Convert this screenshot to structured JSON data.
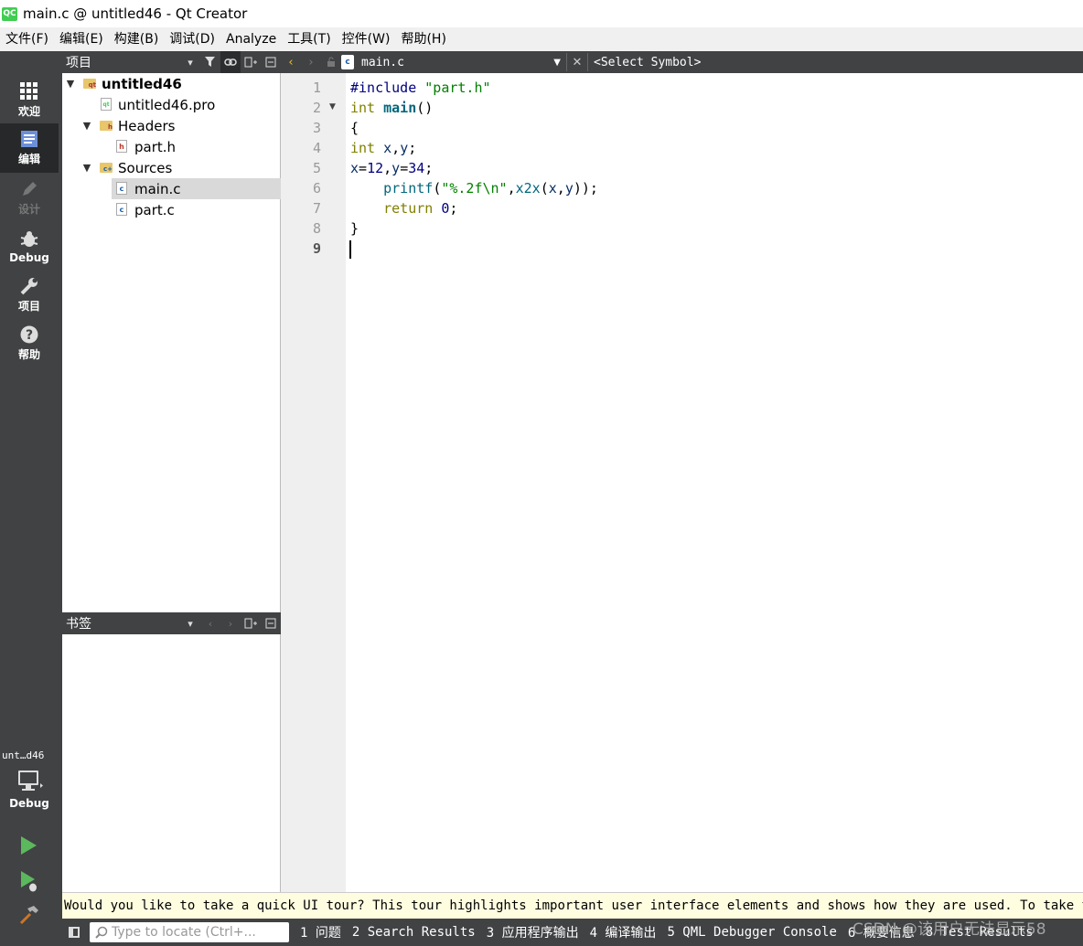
{
  "window": {
    "title": "main.c @ untitled46 - Qt Creator",
    "logo": "QC"
  },
  "menu": [
    "文件(F)",
    "编辑(E)",
    "构建(B)",
    "调试(D)",
    "Analyze",
    "工具(T)",
    "控件(W)",
    "帮助(H)"
  ],
  "modes": [
    {
      "label": "欢迎",
      "icon": "grid-icon",
      "active": false
    },
    {
      "label": "编辑",
      "icon": "document-icon",
      "active": true
    },
    {
      "label": "设计",
      "icon": "pencil-icon",
      "active": false,
      "disabled": true
    },
    {
      "label": "Debug",
      "icon": "bug-icon",
      "active": false
    },
    {
      "label": "项目",
      "icon": "wrench-icon",
      "active": false
    },
    {
      "label": "帮助",
      "icon": "help-icon",
      "active": false
    }
  ],
  "kit": {
    "project": "unt…d46",
    "build": "Debug"
  },
  "projects_pane": {
    "title": "项目"
  },
  "bookmarks_pane": {
    "title": "书签"
  },
  "tree": [
    {
      "label": "untitled46",
      "bold": true
    },
    {
      "label": "untitled46.pro"
    },
    {
      "label": "Headers"
    },
    {
      "label": "part.h"
    },
    {
      "label": "Sources"
    },
    {
      "label": "main.c",
      "selected": true
    },
    {
      "label": "part.c"
    }
  ],
  "editor": {
    "file": "main.c",
    "file_badge": "c",
    "symbol": "<Select Symbol>",
    "current_line": 9,
    "lines": [
      "1",
      "2",
      "3",
      "4",
      "5",
      "6",
      "7",
      "8",
      "9"
    ],
    "code": [
      [
        {
          "t": "#include ",
          "c": "pp"
        },
        {
          "t": "\"part.h\"",
          "c": "str"
        }
      ],
      [
        {
          "t": "int",
          "c": "kw"
        },
        {
          "t": " ",
          "c": ""
        },
        {
          "t": "main",
          "c": "fn"
        },
        {
          "t": "()",
          "c": ""
        }
      ],
      [
        {
          "t": "{",
          "c": ""
        }
      ],
      [
        {
          "t": "int",
          "c": "kw"
        },
        {
          "t": " ",
          "c": ""
        },
        {
          "t": "x",
          "c": "var"
        },
        {
          "t": ",",
          "c": ""
        },
        {
          "t": "y",
          "c": "var"
        },
        {
          "t": ";",
          "c": ""
        }
      ],
      [
        {
          "t": "x",
          "c": "var"
        },
        {
          "t": "=",
          "c": ""
        },
        {
          "t": "12",
          "c": "num"
        },
        {
          "t": ",",
          "c": ""
        },
        {
          "t": "y",
          "c": "var"
        },
        {
          "t": "=",
          "c": ""
        },
        {
          "t": "34",
          "c": "num"
        },
        {
          "t": ";",
          "c": ""
        }
      ],
      [
        {
          "t": "    ",
          "c": ""
        },
        {
          "t": "printf",
          "c": "call"
        },
        {
          "t": "(",
          "c": ""
        },
        {
          "t": "\"%.2f\\n\"",
          "c": "str"
        },
        {
          "t": ",",
          "c": ""
        },
        {
          "t": "x2x",
          "c": "call"
        },
        {
          "t": "(",
          "c": ""
        },
        {
          "t": "x",
          "c": "var"
        },
        {
          "t": ",",
          "c": ""
        },
        {
          "t": "y",
          "c": "var"
        },
        {
          "t": "));",
          "c": ""
        }
      ],
      [
        {
          "t": "    ",
          "c": ""
        },
        {
          "t": "return",
          "c": "kw"
        },
        {
          "t": " ",
          "c": ""
        },
        {
          "t": "0",
          "c": "num"
        },
        {
          "t": ";",
          "c": ""
        }
      ],
      [
        {
          "t": "}",
          "c": ""
        }
      ],
      []
    ]
  },
  "info_bar": "Would you like to take a quick UI tour? This tour highlights important user interface elements and shows how they are used. To take the tour",
  "statusbar": {
    "locator_placeholder": "Type to locate (Ctrl+...",
    "panes": [
      "1 问题",
      "2 Search Results",
      "3 应用程序输出",
      "4 编译输出",
      "5 QML Debugger Console",
      "6 概要信息",
      "8 Test Results"
    ]
  },
  "watermark": "CSDN @该用户无法显示58"
}
